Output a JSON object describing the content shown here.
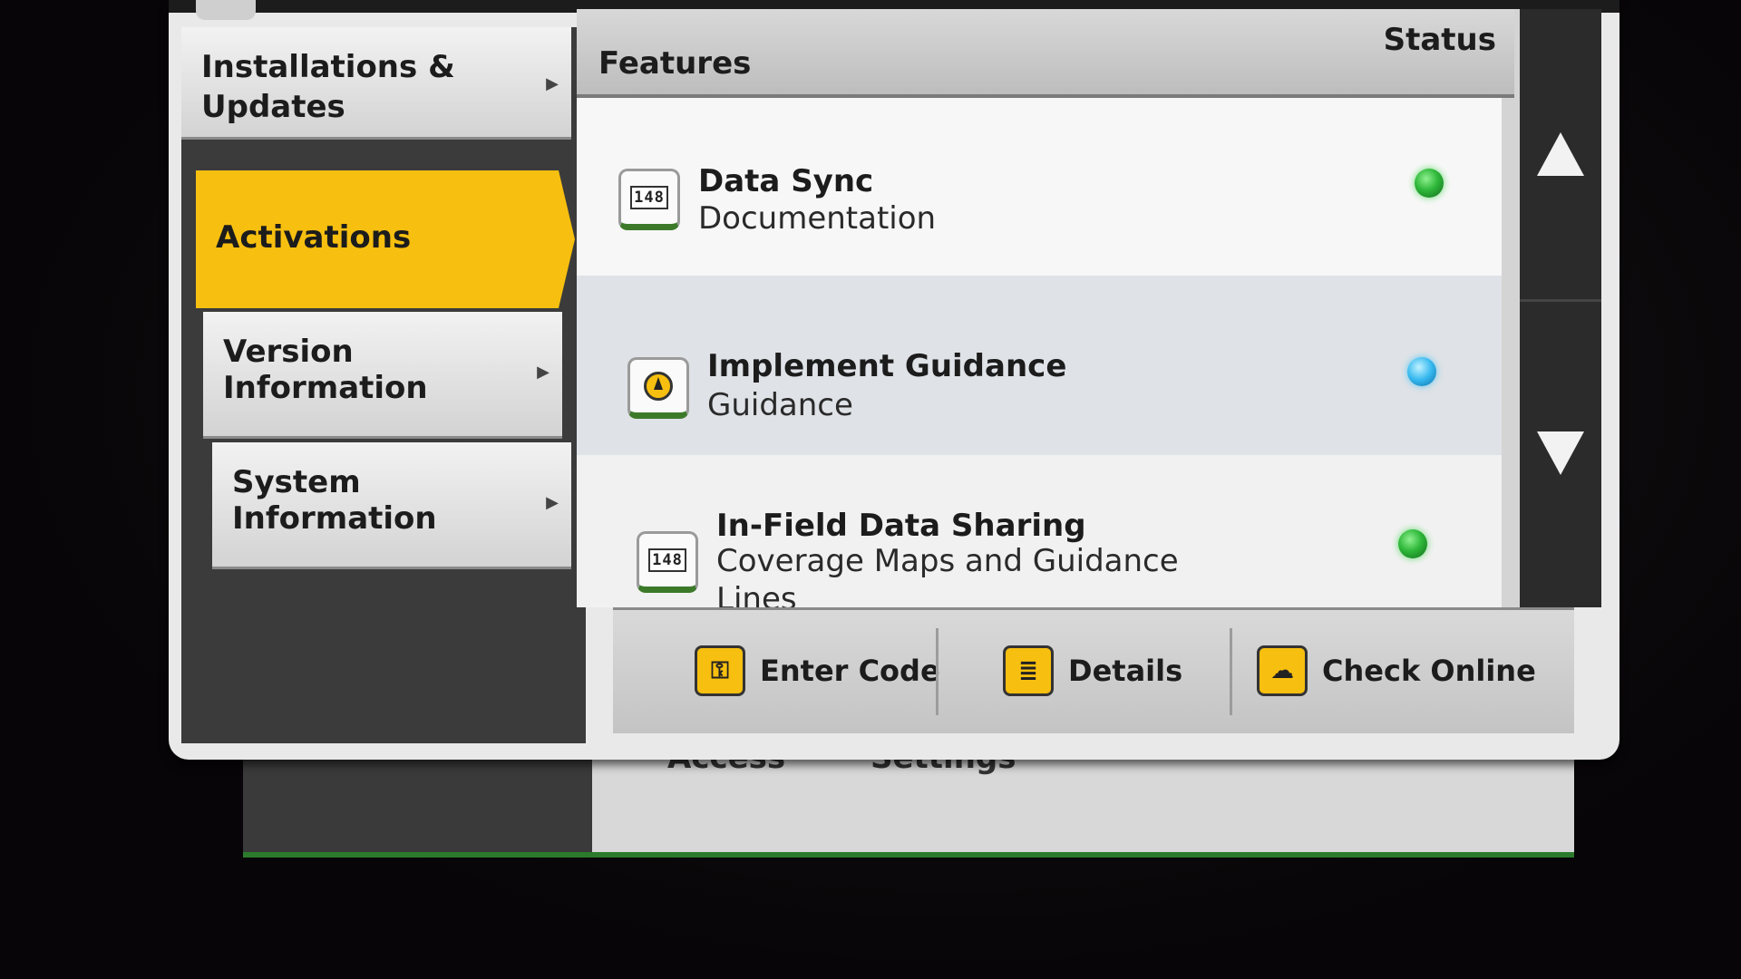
{
  "nav": {
    "items": [
      {
        "label_line1": "Installations &",
        "label_line2": "Updates",
        "has_arrow": true,
        "active": false
      },
      {
        "label_line1": "Activations",
        "label_line2": "",
        "has_arrow": false,
        "active": true
      },
      {
        "label_line1": "Version",
        "label_line2": "Information",
        "has_arrow": true,
        "active": false
      },
      {
        "label_line1": "System",
        "label_line2": "Information",
        "has_arrow": true,
        "active": false
      }
    ],
    "arrow_glyph": "▶"
  },
  "panel": {
    "header_title": "Features",
    "header_status": "Status"
  },
  "features": [
    {
      "title": "Data Sync",
      "subtitle": "Documentation",
      "icon": "counter-icon",
      "icon_text": "148",
      "status_color": "green"
    },
    {
      "title": "Implement Guidance",
      "subtitle": "Guidance",
      "icon": "compass-icon",
      "icon_text": "",
      "status_color": "blue"
    },
    {
      "title": "In-Field Data Sharing",
      "subtitle": "Coverage Maps and Guidance Lines",
      "icon": "counter-icon",
      "icon_text": "148",
      "status_color": "green"
    }
  ],
  "actions": {
    "enter_code": {
      "label": "Enter Code",
      "icon": "key-icon",
      "glyph": "⚿"
    },
    "details": {
      "label": "Details",
      "icon": "document-icon",
      "glyph": "≣"
    },
    "check_online": {
      "label": "Check Online",
      "icon": "cloud-download-icon",
      "glyph": "☁"
    }
  },
  "underlying_screen": {
    "tab_1": "Access",
    "tab_2": "Settings"
  },
  "colors": {
    "accent_yellow": "#f7bf0f",
    "status_green": "#2fb83a",
    "status_blue": "#35b8ef"
  }
}
